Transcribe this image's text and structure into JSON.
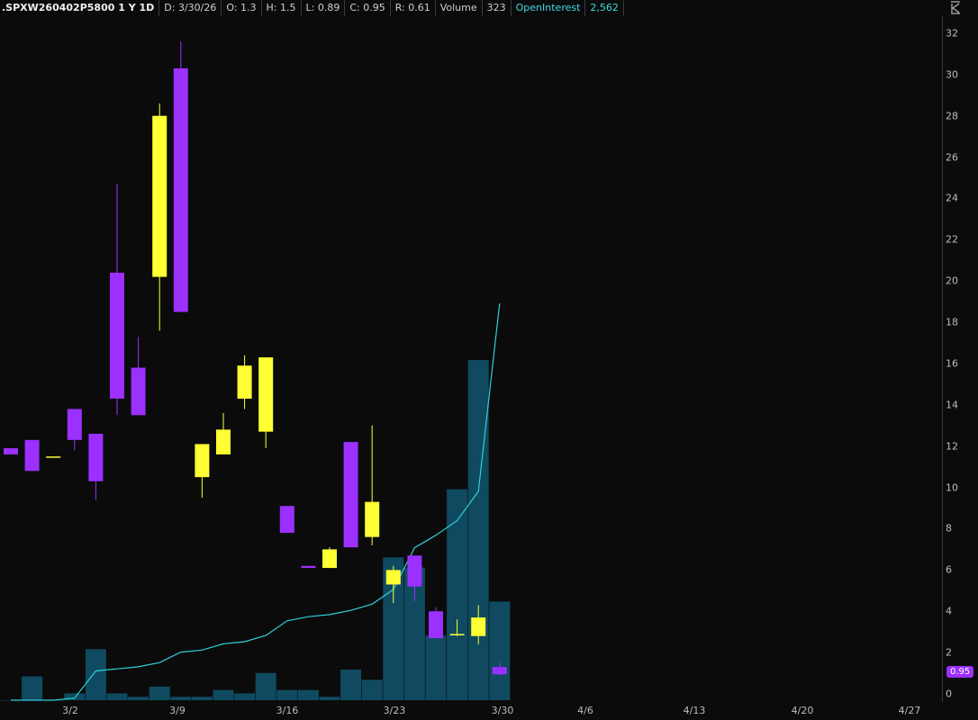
{
  "header": {
    "symbol": ".SPXW260402P5800 1 Y 1D",
    "date": "D: 3/30/26",
    "open": "O: 1.3",
    "high": "H: 1.5",
    "low": "L: 0.89",
    "close": "C: 0.95",
    "range": "R: 0.61",
    "volume_label": "Volume",
    "volume_value": "323",
    "oi_label": "OpenInterest",
    "oi_value": "2,562"
  },
  "colors": {
    "up": "#ffff33",
    "down": "#9b30ff",
    "volume": "#0f4a60",
    "oi_line": "#2fd0d8"
  },
  "last_price_badge": "0.95",
  "chart_data": {
    "type": "candlestick",
    "y_ticks": [
      "32",
      "30",
      "28",
      "26",
      "24",
      "22",
      "20",
      "18",
      "16",
      "14",
      "12",
      "10",
      "8",
      "6",
      "4",
      "2",
      "0"
    ],
    "x_ticks": [
      "3/2",
      "3/9",
      "3/16",
      "3/23",
      "3/30",
      "4/6",
      "4/13",
      "4/20",
      "4/27"
    ],
    "ylim": [
      0,
      32
    ],
    "candles": [
      {
        "o": 11.9,
        "h": 11.9,
        "l": 11.6,
        "c": 11.6
      },
      {
        "o": 12.3,
        "h": 12.3,
        "l": 10.8,
        "c": 10.8
      },
      {
        "o": 11.5,
        "h": 11.5,
        "l": 11.5,
        "c": 11.5
      },
      {
        "o": 13.8,
        "h": 13.8,
        "l": 11.8,
        "c": 12.3
      },
      {
        "o": 12.6,
        "h": 12.6,
        "l": 9.4,
        "c": 10.3
      },
      {
        "o": 20.4,
        "h": 24.7,
        "l": 13.5,
        "c": 14.3
      },
      {
        "o": 15.8,
        "h": 17.3,
        "l": 13.5,
        "c": 13.5
      },
      {
        "o": 20.2,
        "h": 28.6,
        "l": 17.6,
        "c": 28.0
      },
      {
        "o": 30.3,
        "h": 31.6,
        "l": 18.5,
        "c": 18.5
      },
      {
        "o": 10.5,
        "h": 12.0,
        "l": 9.5,
        "c": 12.1
      },
      {
        "o": 11.6,
        "h": 13.6,
        "l": 11.6,
        "c": 12.8
      },
      {
        "o": 14.3,
        "h": 16.4,
        "l": 13.8,
        "c": 15.9
      },
      {
        "o": 12.7,
        "h": 16.3,
        "l": 11.9,
        "c": 16.3
      },
      {
        "o": 9.1,
        "h": 9.1,
        "l": 7.8,
        "c": 7.8
      },
      {
        "o": 6.2,
        "h": 6.2,
        "l": 6.1,
        "c": 6.1
      },
      {
        "o": 6.1,
        "h": 7.1,
        "l": 6.1,
        "c": 7.0
      },
      {
        "o": 12.2,
        "h": 12.2,
        "l": 7.1,
        "c": 7.1
      },
      {
        "o": 7.6,
        "h": 13.0,
        "l": 7.2,
        "c": 9.3
      },
      {
        "o": 5.3,
        "h": 6.2,
        "l": 4.4,
        "c": 6.0
      },
      {
        "o": 6.7,
        "h": 6.7,
        "l": 4.5,
        "c": 5.2
      },
      {
        "o": 4.0,
        "h": 4.2,
        "l": 2.7,
        "c": 2.7
      },
      {
        "o": 2.9,
        "h": 3.6,
        "l": 2.8,
        "c": 2.9
      },
      {
        "o": 2.8,
        "h": 4.3,
        "l": 2.4,
        "c": 3.7
      },
      {
        "o": 1.3,
        "h": 1.5,
        "l": 0.89,
        "c": 0.95
      }
    ],
    "volume_relative": [
      0,
      0.07,
      0,
      0.02,
      0.15,
      0.02,
      0.01,
      0.04,
      0.01,
      0.01,
      0.03,
      0.02,
      0.08,
      0.03,
      0.03,
      0.01,
      0.09,
      0.06,
      0.42,
      0.39,
      0.19,
      0.62,
      1.0,
      0.29
    ],
    "open_interest_relative": [
      0,
      0,
      0,
      0.01,
      0.14,
      0.15,
      0.16,
      0.18,
      0.23,
      0.24,
      0.27,
      0.28,
      0.31,
      0.38,
      0.4,
      0.41,
      0.43,
      0.46,
      0.53,
      0.73,
      0.79,
      0.86,
      1.0,
      1.9
    ]
  }
}
